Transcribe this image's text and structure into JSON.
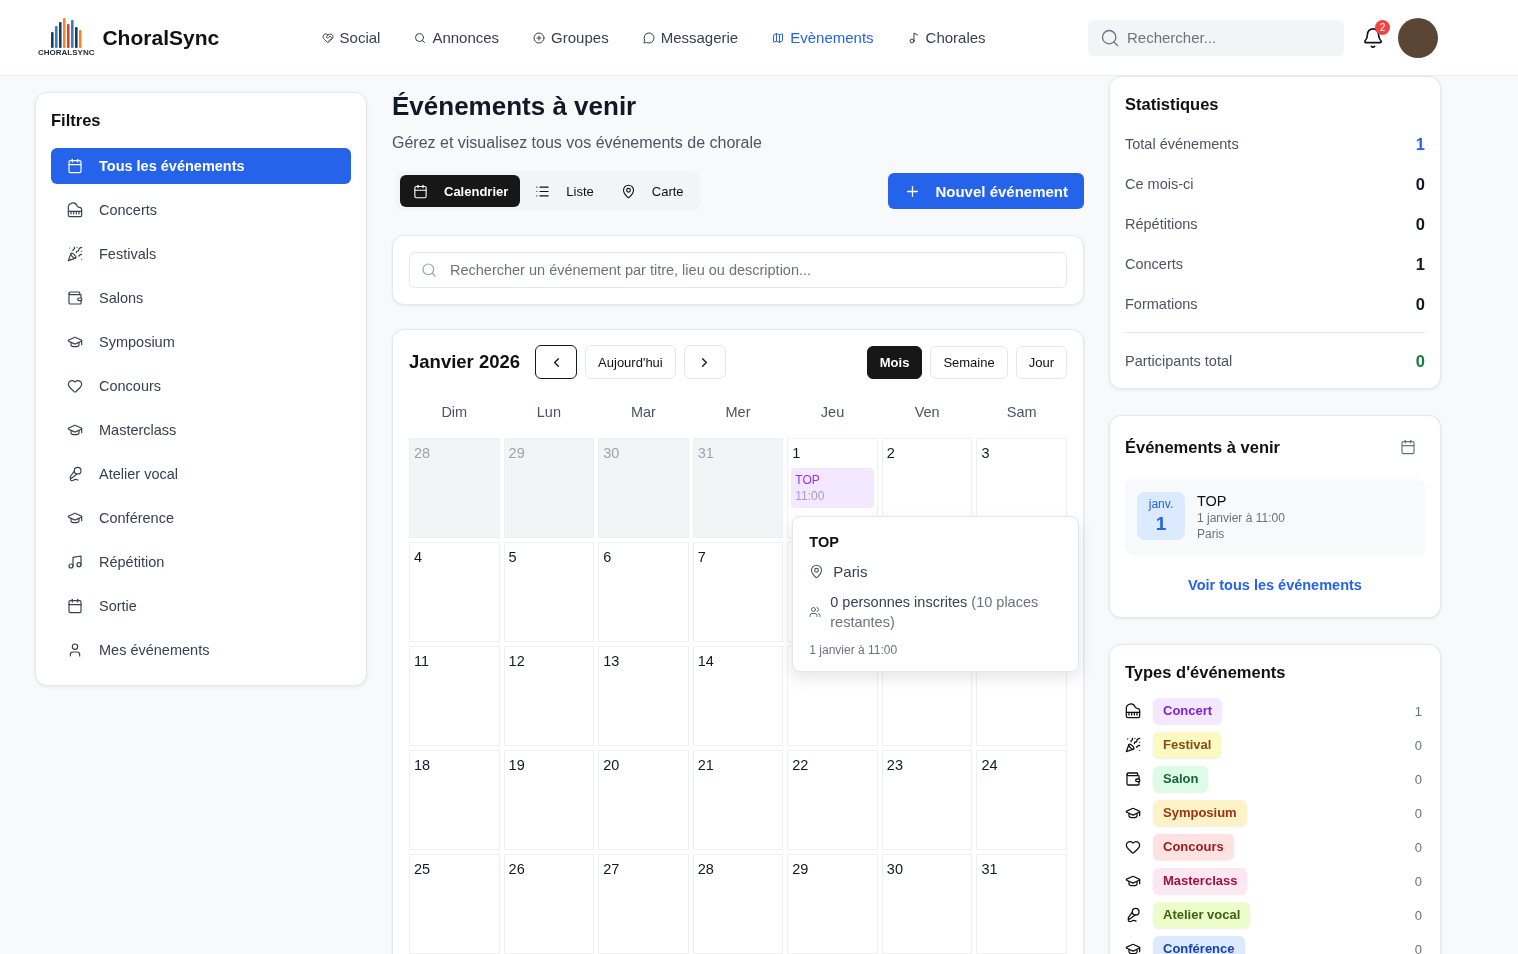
{
  "header": {
    "logo": {
      "caption": "CHORALSYNC",
      "name": "ChoralSync"
    },
    "nav": [
      {
        "label": "Social",
        "kind": "social",
        "selected": false
      },
      {
        "label": "Annonces",
        "kind": "annonces",
        "selected": false
      },
      {
        "label": "Groupes",
        "kind": "groupes",
        "selected": false
      },
      {
        "label": "Messagerie",
        "kind": "messagerie",
        "selected": false
      },
      {
        "label": "Evènements",
        "kind": "evenements",
        "selected": true
      },
      {
        "label": "Chorales",
        "kind": "chorales",
        "selected": false
      }
    ],
    "search": {
      "placeholder": "Rechercher..."
    },
    "notifications": {
      "count": "2"
    }
  },
  "filters": {
    "title": "Filtres",
    "items": [
      {
        "label": "Tous les événements",
        "kind": "all",
        "selected": true
      },
      {
        "label": "Concerts",
        "kind": "concert",
        "selected": false
      },
      {
        "label": "Festivals",
        "kind": "festival",
        "selected": false
      },
      {
        "label": "Salons",
        "kind": "salon",
        "selected": false
      },
      {
        "label": "Symposium",
        "kind": "symposium",
        "selected": false
      },
      {
        "label": "Concours",
        "kind": "concours",
        "selected": false
      },
      {
        "label": "Masterclass",
        "kind": "masterclass",
        "selected": false
      },
      {
        "label": "Atelier vocal",
        "kind": "atelier",
        "selected": false
      },
      {
        "label": "Conférence",
        "kind": "conference",
        "selected": false
      },
      {
        "label": "Répétition",
        "kind": "repetition",
        "selected": false
      },
      {
        "label": "Sortie",
        "kind": "sortie",
        "selected": false
      },
      {
        "label": "Mes événements",
        "kind": "mine",
        "selected": false
      }
    ]
  },
  "main": {
    "title": "Événements à venir",
    "subtitle": "Gérez et visualisez tous vos événements de chorale",
    "views": [
      {
        "label": "Calendrier",
        "kind": "calendar",
        "selected": true
      },
      {
        "label": "Liste",
        "kind": "list",
        "selected": false
      },
      {
        "label": "Carte",
        "kind": "map",
        "selected": false
      }
    ],
    "new_button": "Nouvel événement",
    "search": {
      "placeholder": "Rechercher un événement par titre, lieu ou description..."
    }
  },
  "calendar": {
    "month": "Janvier 2026",
    "prev": {
      "focused": true
    },
    "today_button": "Aujourd'hui",
    "next": {
      "focused": false
    },
    "modes": [
      {
        "label": "Mois",
        "selected": true
      },
      {
        "label": "Semaine",
        "selected": false
      },
      {
        "label": "Jour",
        "selected": false
      }
    ],
    "weekdays": [
      "Dim",
      "Lun",
      "Mar",
      "Mer",
      "Jeu",
      "Ven",
      "Sam"
    ],
    "weeks": [
      [
        {
          "day": "28",
          "outside": true
        },
        {
          "day": "29",
          "outside": true
        },
        {
          "day": "30",
          "outside": true
        },
        {
          "day": "31",
          "outside": true
        },
        {
          "day": "1",
          "outside": false,
          "events": [
            {
              "title": "TOP",
              "time": "11:00",
              "expanded": true,
              "details": {
                "title": "TOP",
                "location": "Paris",
                "attendees": "0 personnes inscrites",
                "remaining": "(10 places restantes)",
                "date": "1 janvier à 11:00"
              }
            }
          ]
        },
        {
          "day": "2",
          "outside": false
        },
        {
          "day": "3",
          "outside": false
        }
      ],
      [
        {
          "day": "4",
          "outside": false
        },
        {
          "day": "5",
          "outside": false
        },
        {
          "day": "6",
          "outside": false
        },
        {
          "day": "7",
          "outside": false
        }
      ],
      [
        {
          "day": "11",
          "outside": false
        },
        {
          "day": "12",
          "outside": false
        },
        {
          "day": "13",
          "outside": false
        },
        {
          "day": "14",
          "outside": false
        }
      ],
      [
        {
          "day": "18",
          "outside": false
        },
        {
          "day": "19",
          "outside": false
        },
        {
          "day": "20",
          "outside": false
        },
        {
          "day": "21",
          "outside": false
        },
        {
          "day": "22",
          "outside": false
        },
        {
          "day": "23",
          "outside": false
        },
        {
          "day": "24",
          "outside": false
        }
      ],
      [
        {
          "day": "25",
          "outside": false
        },
        {
          "day": "26",
          "outside": false
        },
        {
          "day": "27",
          "outside": false
        },
        {
          "day": "28",
          "outside": false
        },
        {
          "day": "29",
          "outside": false
        },
        {
          "day": "30",
          "outside": false
        },
        {
          "day": "31",
          "outside": false
        }
      ]
    ]
  },
  "stats": {
    "title": "Statistiques",
    "rows": [
      {
        "label": "Total événements",
        "value": "1",
        "color": "#2563eb"
      },
      {
        "label": "Ce mois-ci",
        "value": "0",
        "color": "#111827"
      },
      {
        "label": "Répétitions",
        "value": "0",
        "color": "#111827"
      },
      {
        "label": "Concerts",
        "value": "1",
        "color": "#111827"
      },
      {
        "label": "Formations",
        "value": "0",
        "color": "#111827"
      }
    ],
    "total": {
      "label": "Participants total",
      "value": "0",
      "color": "#15803d"
    }
  },
  "upcoming": {
    "title": "Événements à venir",
    "items": [
      {
        "month": "janv.",
        "day": "1",
        "title": "TOP",
        "date": "1 janvier à 11:00",
        "location": "Paris"
      }
    ],
    "link": "Voir tous les événements"
  },
  "types": {
    "title": "Types d'événements",
    "items": [
      {
        "label": "Concert",
        "kind": "concert",
        "color": "#f3e8ff",
        "count": "1"
      },
      {
        "label": "Festival",
        "kind": "festival",
        "color": "#fef9c3",
        "count": "0"
      },
      {
        "label": "Salon",
        "kind": "salon",
        "color": "#dcfce7",
        "count": "0"
      },
      {
        "label": "Symposium",
        "kind": "symposium",
        "color": "#fef3c7",
        "count": "0"
      },
      {
        "label": "Concours",
        "kind": "concours",
        "color": "#fee2e2",
        "count": "0"
      },
      {
        "label": "Masterclass",
        "kind": "masterclass",
        "color": "#fce7f3",
        "count": "0"
      },
      {
        "label": "Atelier vocal",
        "kind": "atelier",
        "color": "#ecfccb",
        "count": "0"
      },
      {
        "label": "Conférence",
        "kind": "conference",
        "color": "#dbeafe",
        "count": "0"
      }
    ]
  }
}
